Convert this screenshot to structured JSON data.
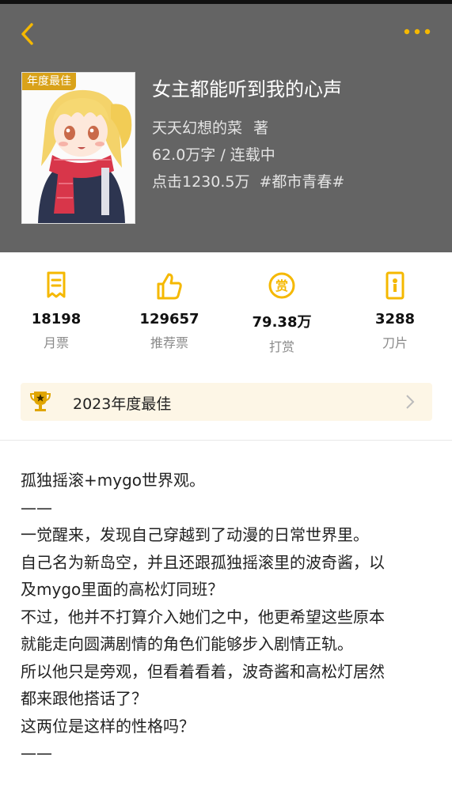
{
  "nav": {
    "back_icon": "chevron-left-icon",
    "more_icon": "ellipsis-icon",
    "accent_color": "#f5b800"
  },
  "book": {
    "badge": "年度最佳",
    "title": "女主都能听到我的心声",
    "author": "天天幻想的菜",
    "author_suffix": "著",
    "words": "62.0万字 / 连载中",
    "clicks": "点击1230.5万",
    "tag": "#都市青春#"
  },
  "stats": [
    {
      "value": "18198",
      "label": "月票",
      "icon": "ticket-icon"
    },
    {
      "value": "129657",
      "label": "推荐票",
      "icon": "thumbs-up-icon"
    },
    {
      "value": "79.38万",
      "label": "打赏",
      "icon": "reward-coin-icon"
    },
    {
      "value": "3288",
      "label": "刀片",
      "icon": "blade-icon"
    }
  ],
  "award": {
    "text": "2023年度最佳",
    "icon": "trophy-icon"
  },
  "intro": [
    "孤独摇滚+mygo世界观。",
    "——",
    "一觉醒来，发现自己穿越到了动漫的日常世界里。",
    "自己名为新岛空，并且还跟孤独摇滚里的波奇酱，以",
    "及mygo里面的高松灯同班？",
    "不过，他并不打算介入她们之中，他更希望这些原本",
    "就能走向圆满剧情的角色们能够步入剧情正轨。",
    "所以他只是旁观，但看着看着，波奇酱和高松灯居然",
    "都来跟他搭话了？",
    "这两位是这样的性格吗？",
    "——"
  ]
}
